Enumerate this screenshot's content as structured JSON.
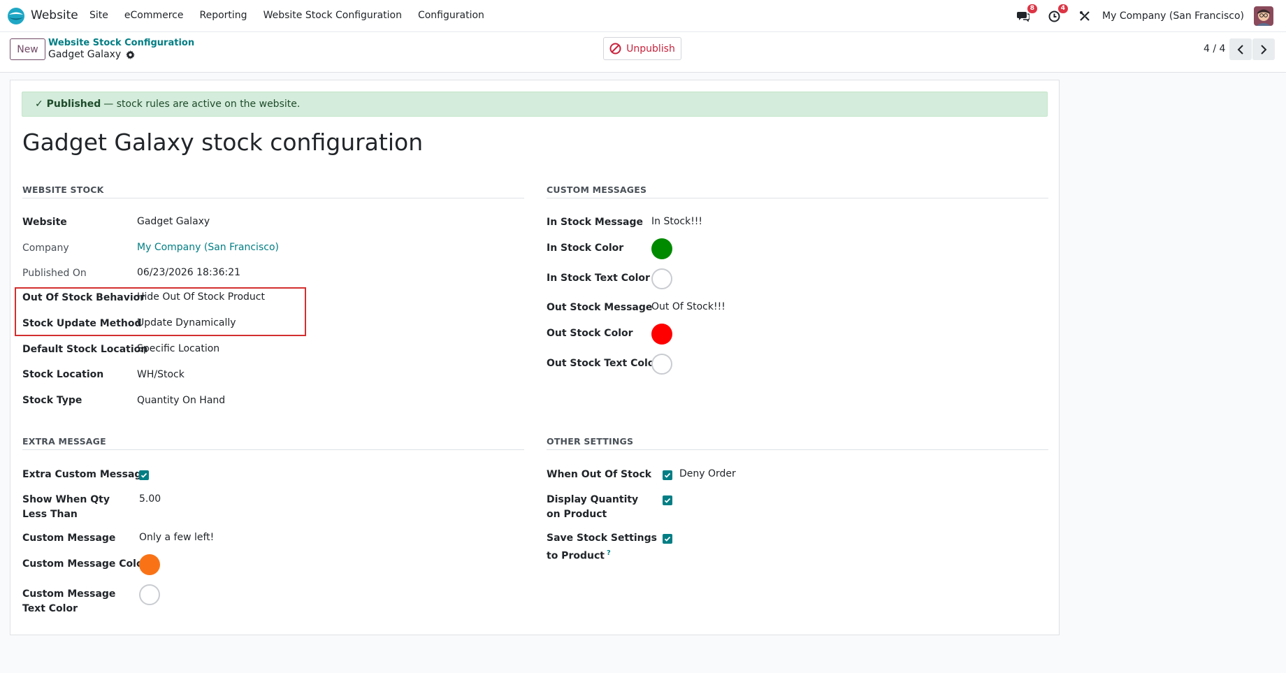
{
  "navbar": {
    "app_name": "Website",
    "menu": [
      "Site",
      "eCommerce",
      "Reporting",
      "Website Stock Configuration",
      "Configuration"
    ],
    "messages_badge": "8",
    "activities_badge": "4",
    "company": "My Company (San Francisco)"
  },
  "control_panel": {
    "new_label": "New",
    "breadcrumb": "Website Stock Configuration",
    "record_name": "Gadget Galaxy",
    "unpublish_label": "Unpublish",
    "pager": "4 / 4"
  },
  "alert": {
    "strong": "✓ Published",
    "text": "— stock rules are active on the website."
  },
  "title": "Gadget Galaxy stock configuration",
  "website_stock": {
    "heading": "WEBSITE STOCK",
    "website_label": "Website",
    "website_value": "Gadget Galaxy",
    "company_label": "Company",
    "company_value": "My Company (San Francisco)",
    "published_label": "Published On",
    "published_value": "06/23/2026 18:36:21",
    "oos_behavior_label": "Out Of Stock Behavior",
    "oos_behavior_value": "Hide Out Of Stock Product",
    "update_method_label": "Stock Update Method",
    "update_method_value": "Update Dynamically",
    "default_location_label": "Default Stock Location",
    "default_location_value": "Specific Location",
    "stock_location_label": "Stock Location",
    "stock_location_value": "WH/Stock",
    "stock_type_label": "Stock Type",
    "stock_type_value": "Quantity On Hand"
  },
  "custom_messages": {
    "heading": "CUSTOM MESSAGES",
    "in_msg_label": "In Stock Message",
    "in_msg_value": "In Stock!!!",
    "in_color_label": "In Stock Color",
    "in_color": "#008a00",
    "in_text_color_label": "In Stock Text Color",
    "in_text_color": "#ffffff",
    "out_msg_label": "Out Stock Message",
    "out_msg_value": "Out Of Stock!!!",
    "out_color_label": "Out Stock Color",
    "out_color": "#ff0000",
    "out_text_color_label": "Out Stock Text Color",
    "out_text_color": "#ffffff"
  },
  "extra_message": {
    "heading": "EXTRA MESSAGE",
    "extra_custom_label": "Extra Custom Message",
    "extra_custom_checked": true,
    "qty_less_label": "Show When Qty Less Than",
    "qty_less_value": "5.00",
    "custom_msg_label": "Custom Message",
    "custom_msg_value": "Only a few left!",
    "custom_color_label": "Custom Message Color",
    "custom_color": "#f97316",
    "custom_text_color_label": "Custom Message Text Color",
    "custom_text_color": "#ffffff"
  },
  "other_settings": {
    "heading": "OTHER SETTINGS",
    "when_oos_label": "When Out Of Stock",
    "when_oos_value": "Deny Order",
    "display_qty_label": "Display Quantity on Product",
    "save_settings_label": "Save Stock Settings to Product",
    "help_mark": "?"
  }
}
